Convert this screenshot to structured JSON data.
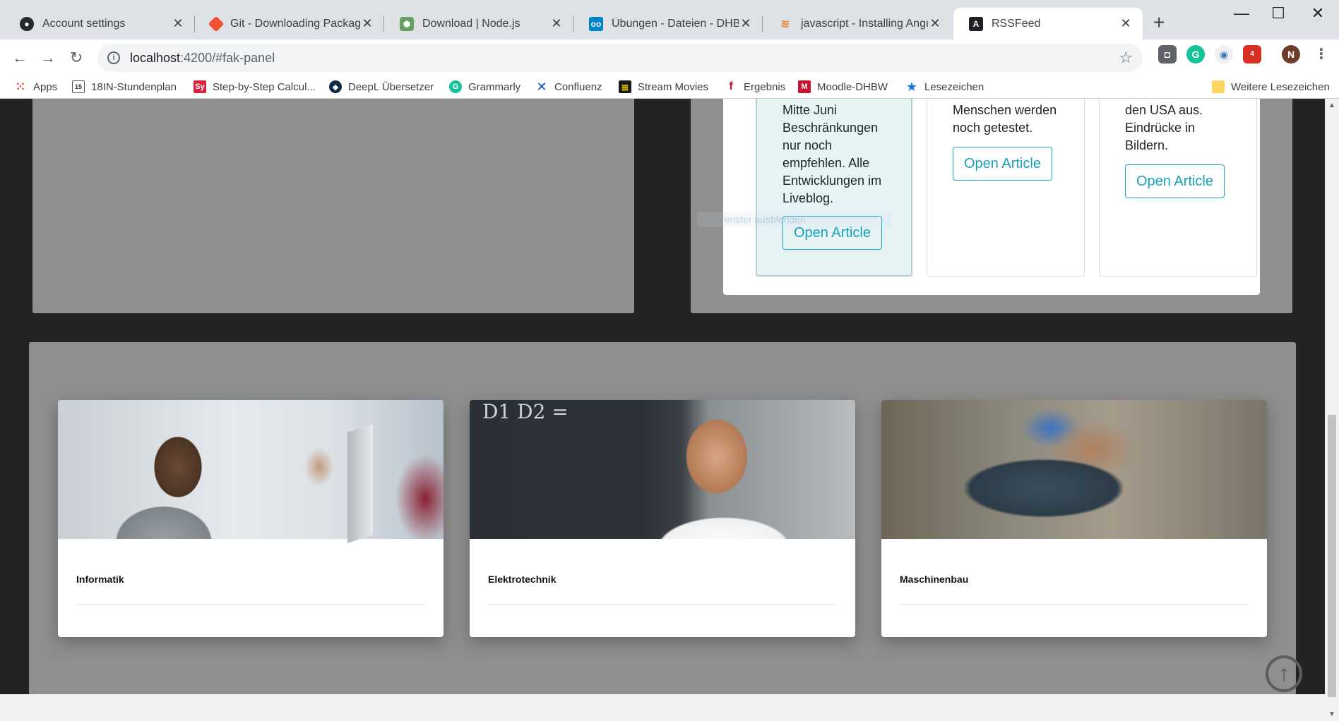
{
  "browser": {
    "tabs": [
      {
        "title": "Account settings",
        "icon": "github-icon",
        "color": "#24292e"
      },
      {
        "title": "Git - Downloading Package",
        "icon": "git-icon",
        "color": "#f05133"
      },
      {
        "title": "Download | Node.js",
        "icon": "nodejs-icon",
        "color": "#68a063"
      },
      {
        "title": "Übungen - Dateien - DHBW",
        "icon": "nextcloud-icon",
        "color": "#0082c9"
      },
      {
        "title": "javascript - Installing Angula",
        "icon": "stackoverflow-icon",
        "color": "#f48024"
      },
      {
        "title": "RSSFeed",
        "icon": "angular-icon",
        "color": "#202124"
      }
    ],
    "active_tab": 5,
    "url_host": "localhost",
    "url_path": ":4200/#fak-panel",
    "profile_initial": "N",
    "abp_badge": "4"
  },
  "bookmarks": [
    {
      "label": "Apps",
      "icon": "apps-grid-icon"
    },
    {
      "label": "18IN-Stundenplan",
      "icon": "calendar-icon"
    },
    {
      "label": "Step-by-Step Calcul...",
      "icon": "symbolab-icon"
    },
    {
      "label": "DeepL Übersetzer",
      "icon": "deepl-icon"
    },
    {
      "label": "Grammarly",
      "icon": "grammarly-icon"
    },
    {
      "label": "Confluenz",
      "icon": "confluence-icon"
    },
    {
      "label": "Stream Movies",
      "icon": "stream-icon"
    },
    {
      "label": "Ergebnis",
      "icon": "ergebnis-icon"
    },
    {
      "label": "Moodle-DHBW",
      "icon": "moodle-icon"
    },
    {
      "label": "Lesezeichen",
      "icon": "star-icon"
    },
    {
      "label": "Weitere Lesezeichen",
      "icon": "folder-icon"
    }
  ],
  "news_cards": [
    {
      "text": "Mitte Juni Beschränkungen nur noch empfehlen. Alle Entwicklungen im Liveblog.",
      "button": "Open Article"
    },
    {
      "text": "Menschen werden noch getestet.",
      "button": "Open Article"
    },
    {
      "text": "den USA aus. Eindrücke in Bildern.",
      "button": "Open Article"
    }
  ],
  "ghost_text": "Fenster ausblenden",
  "faculties": [
    {
      "title": "Informatik",
      "image": "student-at-computer"
    },
    {
      "title": "Elektrotechnik",
      "image": "student-at-chalkboard"
    },
    {
      "title": "Maschinenbau",
      "image": "robot-car-build"
    }
  ],
  "chalk_text": "D1 D2 =",
  "colors": {
    "accent": "#17a2b8",
    "panel": "#8f8f8f",
    "page_bg": "#232323"
  }
}
